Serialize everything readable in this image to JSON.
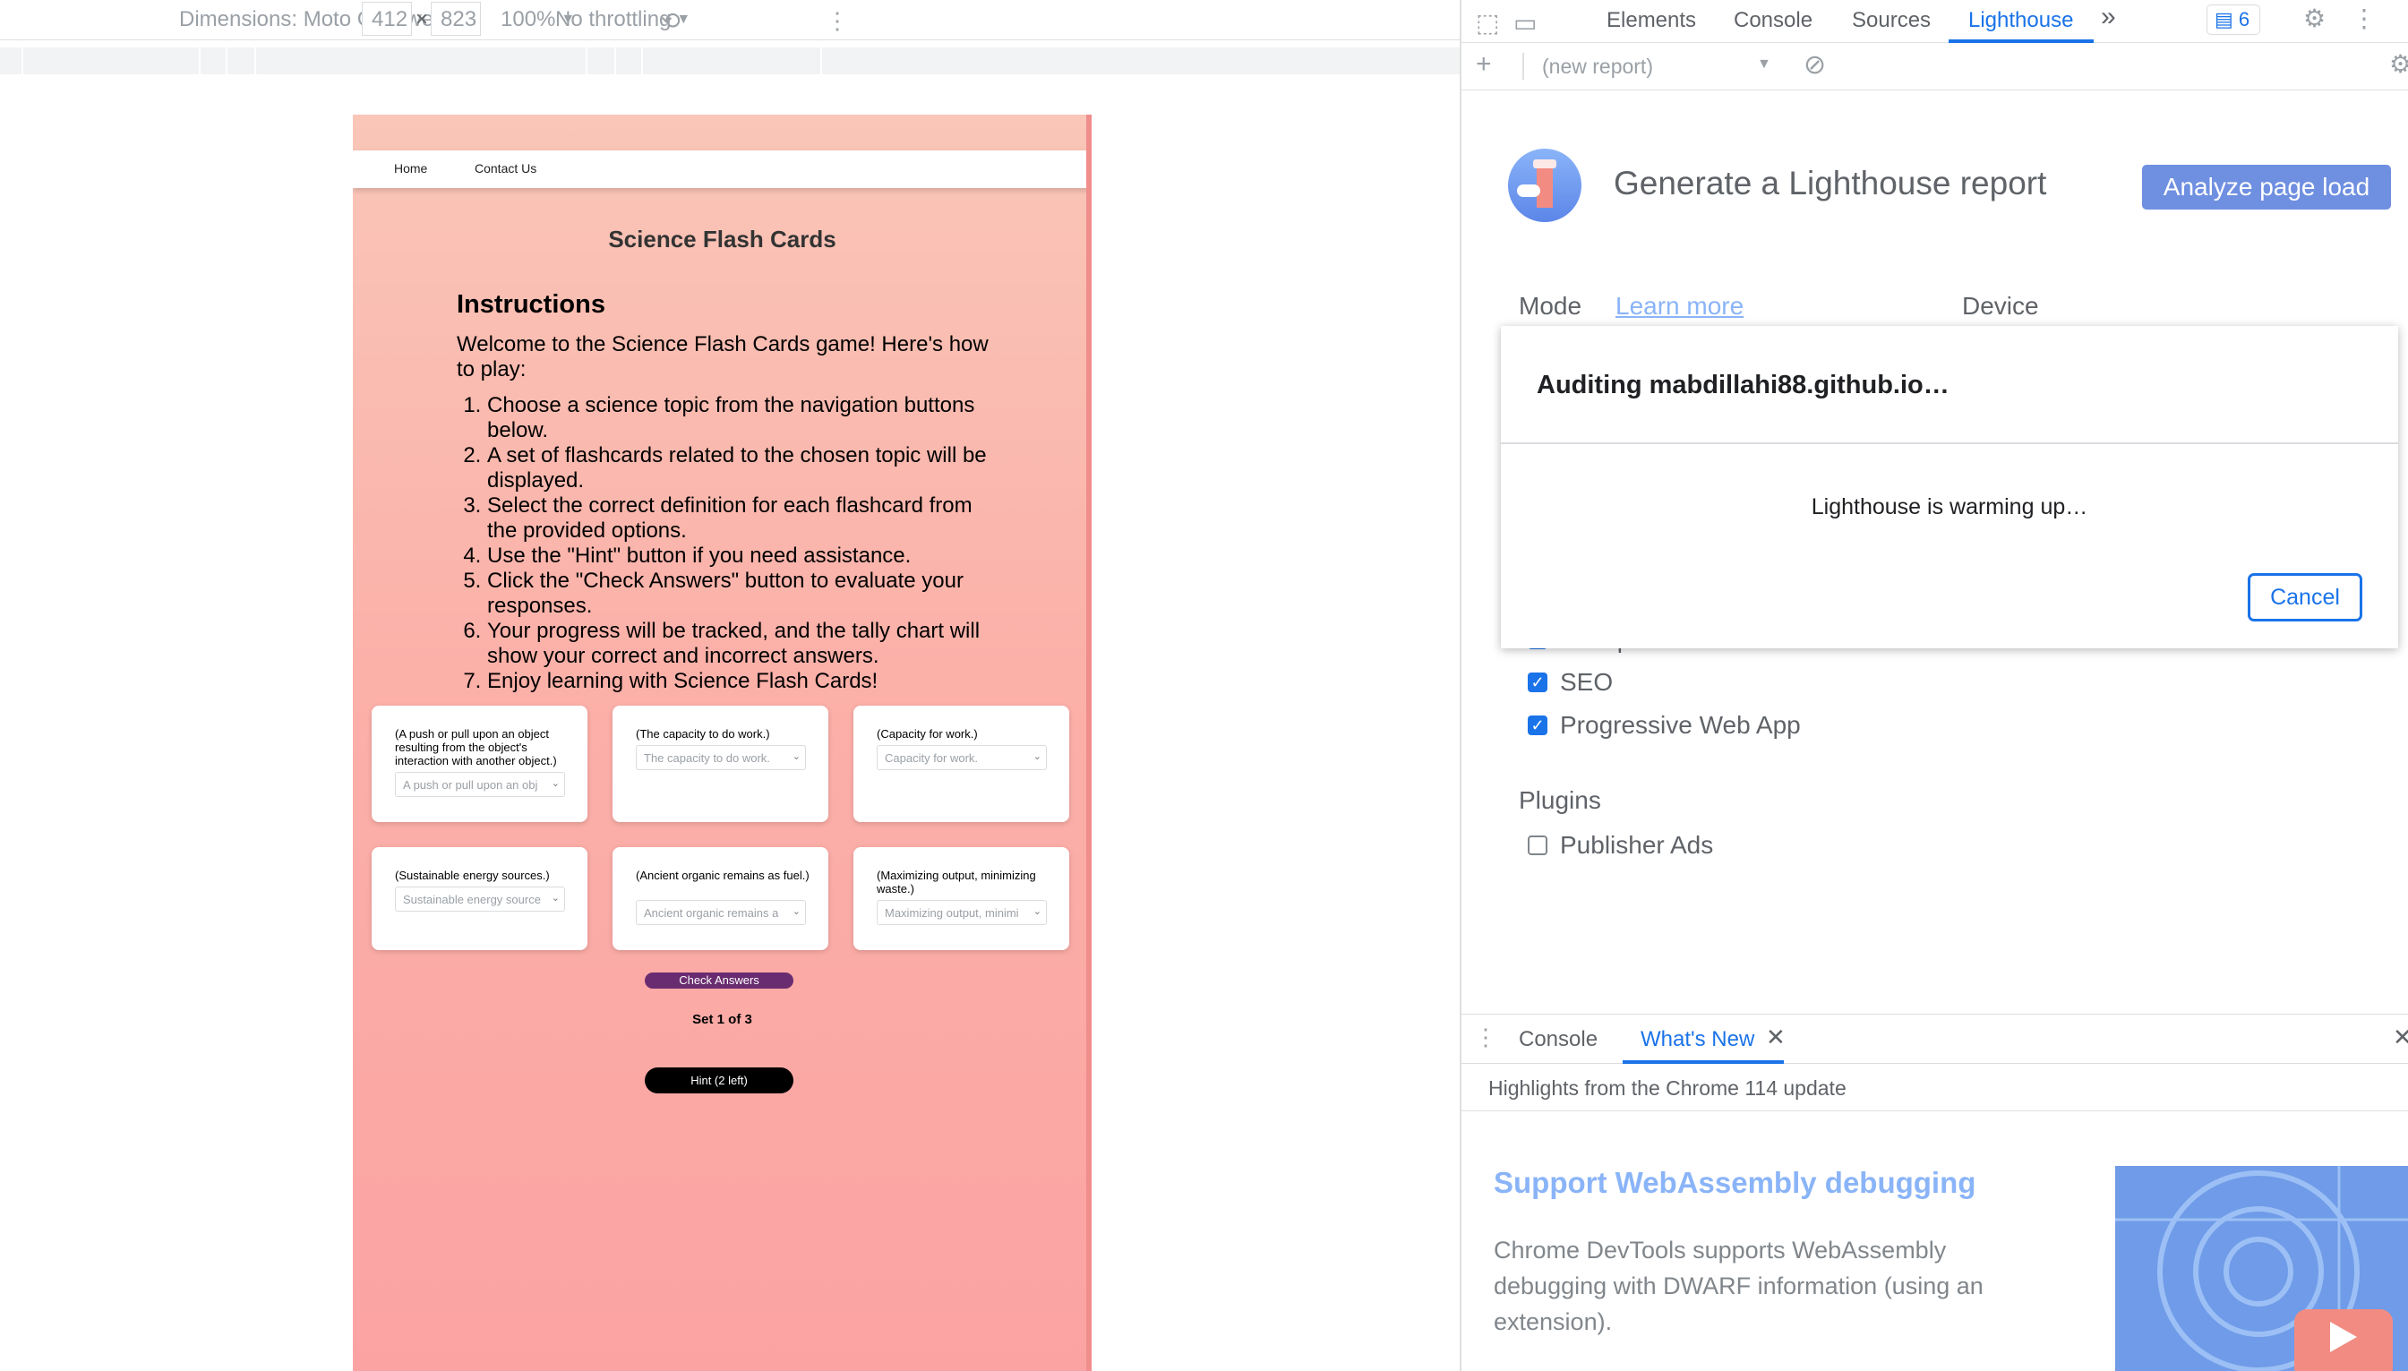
{
  "device_toolbar": {
    "dimensions": "Dimensions: Moto G Power",
    "width": "412",
    "times": "×",
    "height": "823",
    "zoom": "100%",
    "throttling": "No throttling"
  },
  "site": {
    "nav": [
      "Home",
      "Contact Us"
    ],
    "title": "Science Flash Cards",
    "instructions_heading": "Instructions",
    "intro": "Welcome to the Science Flash Cards game! Here's how to play:",
    "steps": [
      "Choose a science topic from the navigation buttons below.",
      "A set of flashcards related to the chosen topic will be displayed.",
      "Select the correct definition for each flashcard from the provided options.",
      "Use the \"Hint\" button if you need assistance.",
      "Click the \"Check Answers\" button to evaluate your responses.",
      "Your progress will be tracked, and the tally chart will show your correct and incorrect answers.",
      "Enjoy learning with Science Flash Cards!"
    ],
    "cards": [
      {
        "question": "(A push or pull upon an object resulting from the object's interaction with another object.)",
        "selected": "A push or pull upon an obj"
      },
      {
        "question": "(The capacity to do work.)",
        "selected": "The capacity to do work."
      },
      {
        "question": "(Capacity for work.)",
        "selected": "Capacity for work."
      },
      {
        "question": "(Sustainable energy sources.)",
        "selected": "Sustainable energy source"
      },
      {
        "question": "(Ancient organic remains as fuel.)",
        "selected": "Ancient organic remains a"
      },
      {
        "question": "(Maximizing output, minimizing waste.)",
        "selected": "Maximizing output, minimi"
      }
    ],
    "check_answers": "Check Answers",
    "set_label": "Set 1 of 3",
    "hint": "Hint (2 left)"
  },
  "devtools": {
    "tabs": [
      "Elements",
      "Console",
      "Sources",
      "Lighthouse"
    ],
    "active_tab": "Lighthouse",
    "more": "»",
    "issues_count": "6",
    "new_report": "(new report)",
    "generate_title": "Generate a Lighthouse report",
    "analyze_button": "Analyze page load",
    "mode_label": "Mode",
    "learn_more": "Learn more",
    "device_label": "Device",
    "categories": [
      {
        "label": "Best practices",
        "checked": true
      },
      {
        "label": "SEO",
        "checked": true
      },
      {
        "label": "Progressive Web App",
        "checked": true
      }
    ],
    "plugins_label": "Plugins",
    "plugins": [
      {
        "label": "Publisher Ads",
        "checked": false
      }
    ],
    "dialog": {
      "title": "Auditing mabdillahi88.github.io…",
      "message": "Lighthouse is warming up…",
      "cancel": "Cancel"
    },
    "drawer": {
      "tabs": [
        "Console",
        "What's New"
      ],
      "active_tab": "What's New",
      "highlights": "Highlights from the Chrome 114 update",
      "article_title": "Support WebAssembly debugging",
      "article_body": "Chrome DevTools supports WebAssembly debugging with DWARF information (using an extension)."
    }
  },
  "colors": {
    "accent": "#1a73e8",
    "check_answers_bg": "#6a2c70",
    "viewport_bg": "#fba3a3"
  }
}
